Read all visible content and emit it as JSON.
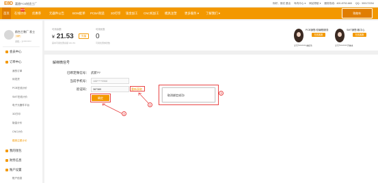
{
  "brand": {
    "logo": "E8D",
    "subtitle": "嘉捷PCB制造工厂"
  },
  "toplinks": [
    "你好，测试 退出",
    "年内中心 ▾",
    "网站导航 ▾",
    "服务热线：400-8752-665",
    "QQ：300172254"
  ],
  "nav": {
    "items": [
      "首页",
      "在线计价",
      "优惠券",
      "元器件公告",
      "BOM配单",
      "PCBA制造",
      "3D打印",
      "钣金加工",
      "CNC机加工",
      "模具注塑",
      "更多服务 ▾",
      "了解我们 ▾"
    ],
    "hot_badge": "HOT",
    "cart_label": "购物车"
  },
  "user": {
    "name": "前台工装厂 发士",
    "level": "VIP",
    "phone": "手机：1**********"
  },
  "sidebar": {
    "sections": [
      {
        "title": "会员中心",
        "items": []
      },
      {
        "title": "订单中心",
        "items": [
          "我的订单",
          "待发货",
          "PCB在线计价",
          "SMT在线计价",
          "电子元器件平台",
          "3D打印",
          "钣金计价",
          "CNC计价",
          "模具注塑计价"
        ]
      },
      {
        "title": "我的钱包",
        "items": []
      },
      {
        "title": "财务信息",
        "items": []
      },
      {
        "title": "账户设置",
        "items": [
          "账户信息"
        ]
      }
    ]
  },
  "wallet": {
    "balance_label": "可用余额",
    "currency": "¥",
    "balance": "21.53",
    "recharge_label": "充值",
    "balance_note": "其中可用优惠余额 ¥21.53",
    "coupon_label": "可用优惠",
    "coupon_value": "0",
    "coupon_note": "可用优惠券张数"
  },
  "reps": [
    {
      "title": "PCB销售/总编程服务",
      "button": "在线客服",
      "phone": "177*******4623"
    },
    {
      "title": "SMT销售/客中心",
      "button": "在线客服",
      "phone": "177*******7064"
    }
  ],
  "unbind": {
    "title": "解绑微信号",
    "wechat_label": "已绑定微信号：",
    "wechat_value": "武新??",
    "phone_label": "当前手机号：",
    "phone_value": "188*****0968",
    "code_label": "验证码：",
    "code_value": "387389",
    "get_code_label": "重新获取",
    "submit_label": "确定"
  },
  "popup": {
    "message": "取消绑定成功!"
  },
  "annotations": [
    "①",
    "②",
    "③"
  ],
  "colors": {
    "accent": "#f39800",
    "annotation": "#e84343"
  }
}
